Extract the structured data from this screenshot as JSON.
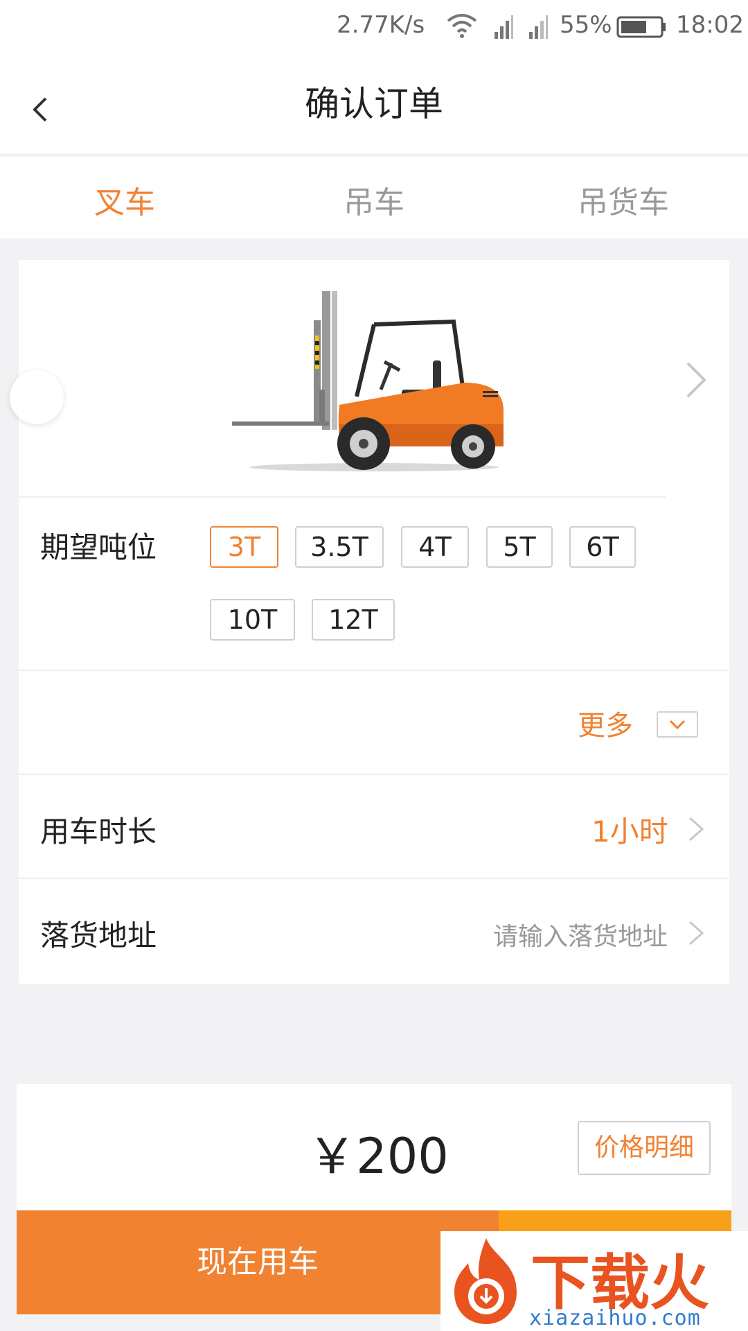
{
  "status_bar": {
    "net_speed": "2.77K/s",
    "battery_pct": "55%",
    "time": "18:02",
    "icons": [
      "wifi-icon",
      "signal-icon",
      "signal-icon",
      "battery-icon"
    ]
  },
  "header": {
    "title": "确认订单",
    "back_icon": "chevron-left-icon"
  },
  "tabs": [
    {
      "label": "叉车",
      "active": true
    },
    {
      "label": "吊车",
      "active": false
    },
    {
      "label": "吊货车",
      "active": false
    }
  ],
  "vehicle": {
    "image": "forklift-illustration",
    "next_icon": "chevron-right-icon"
  },
  "tonnage": {
    "label": "期望吨位",
    "options": [
      "3T",
      "3.5T",
      "4T",
      "5T",
      "6T",
      "10T",
      "12T"
    ],
    "selected": "3T"
  },
  "more": {
    "label": "更多",
    "toggle_icon": "chevron-down-icon"
  },
  "duration": {
    "label": "用车时长",
    "value": "1小时"
  },
  "address": {
    "label": "落货地址",
    "placeholder": "请输入落货地址"
  },
  "price": {
    "amount": "￥200",
    "detail_button": "价格明细"
  },
  "actions": {
    "now_label": "现在用车"
  },
  "watermark": {
    "text": "下载火",
    "url": "xiazaihuo.com"
  },
  "colors": {
    "accent": "#f08231",
    "accent_secondary": "#f9a01b",
    "background": "#f2f2f4"
  }
}
